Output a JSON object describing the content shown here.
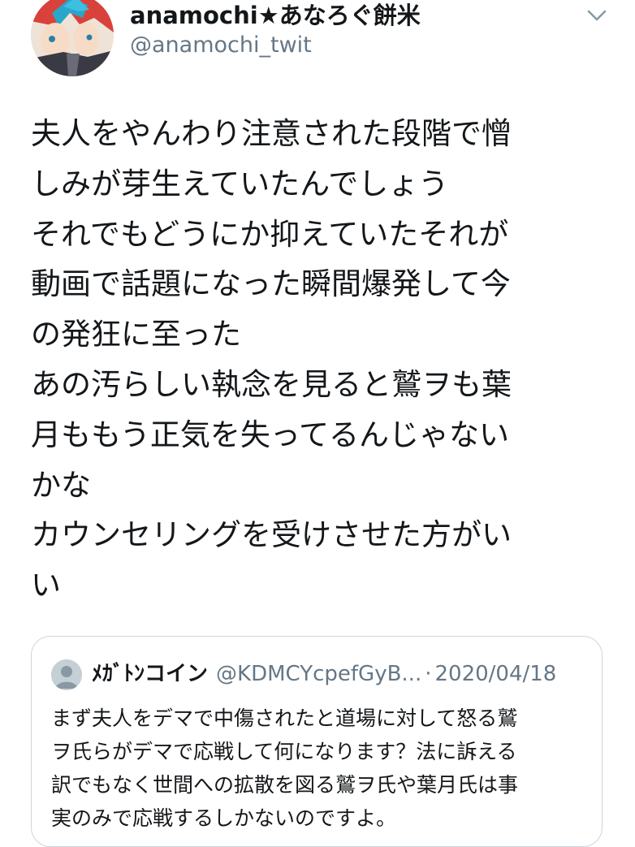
{
  "tweet": {
    "display_name": "anamochi★あなろぐ餅米",
    "handle": "@anamochi_twit",
    "text_lines": [
      "夫人をやんわり注意された段階で憎",
      "しみが芽生えていたんでしょう",
      "それでもどうにか抑えていたそれが",
      "動画で話題になった瞬間爆発して今",
      "の発狂に至った",
      "あの汚らしい執念を見ると鷲ヲも葉",
      "月ももう正気を失ってるんじゃない",
      "かな",
      "カウンセリングを受けさせた方がい",
      "い"
    ]
  },
  "quote": {
    "display_name": "ﾒｶﾞﾄﾝコイン",
    "handle": "@KDMCYcpefGyB...",
    "separator": "·",
    "date": "2020/04/18",
    "text_lines": [
      "まず夫人をデマで中傷されたと道場に対して怒る鷲",
      "ヲ氏らがデマで応戦して何になります？法に訴える",
      "訳でもなく世間への拡散を図る鷲ヲ氏や葉月氏は事",
      "実のみで応戦するしかないのですよ。"
    ]
  },
  "icons": {
    "caret": "chevron-down-icon",
    "quote_avatar": "default-avatar-icon"
  },
  "colors": {
    "text": "#14171a",
    "secondary": "#657786",
    "border": "#ccd6dd"
  }
}
